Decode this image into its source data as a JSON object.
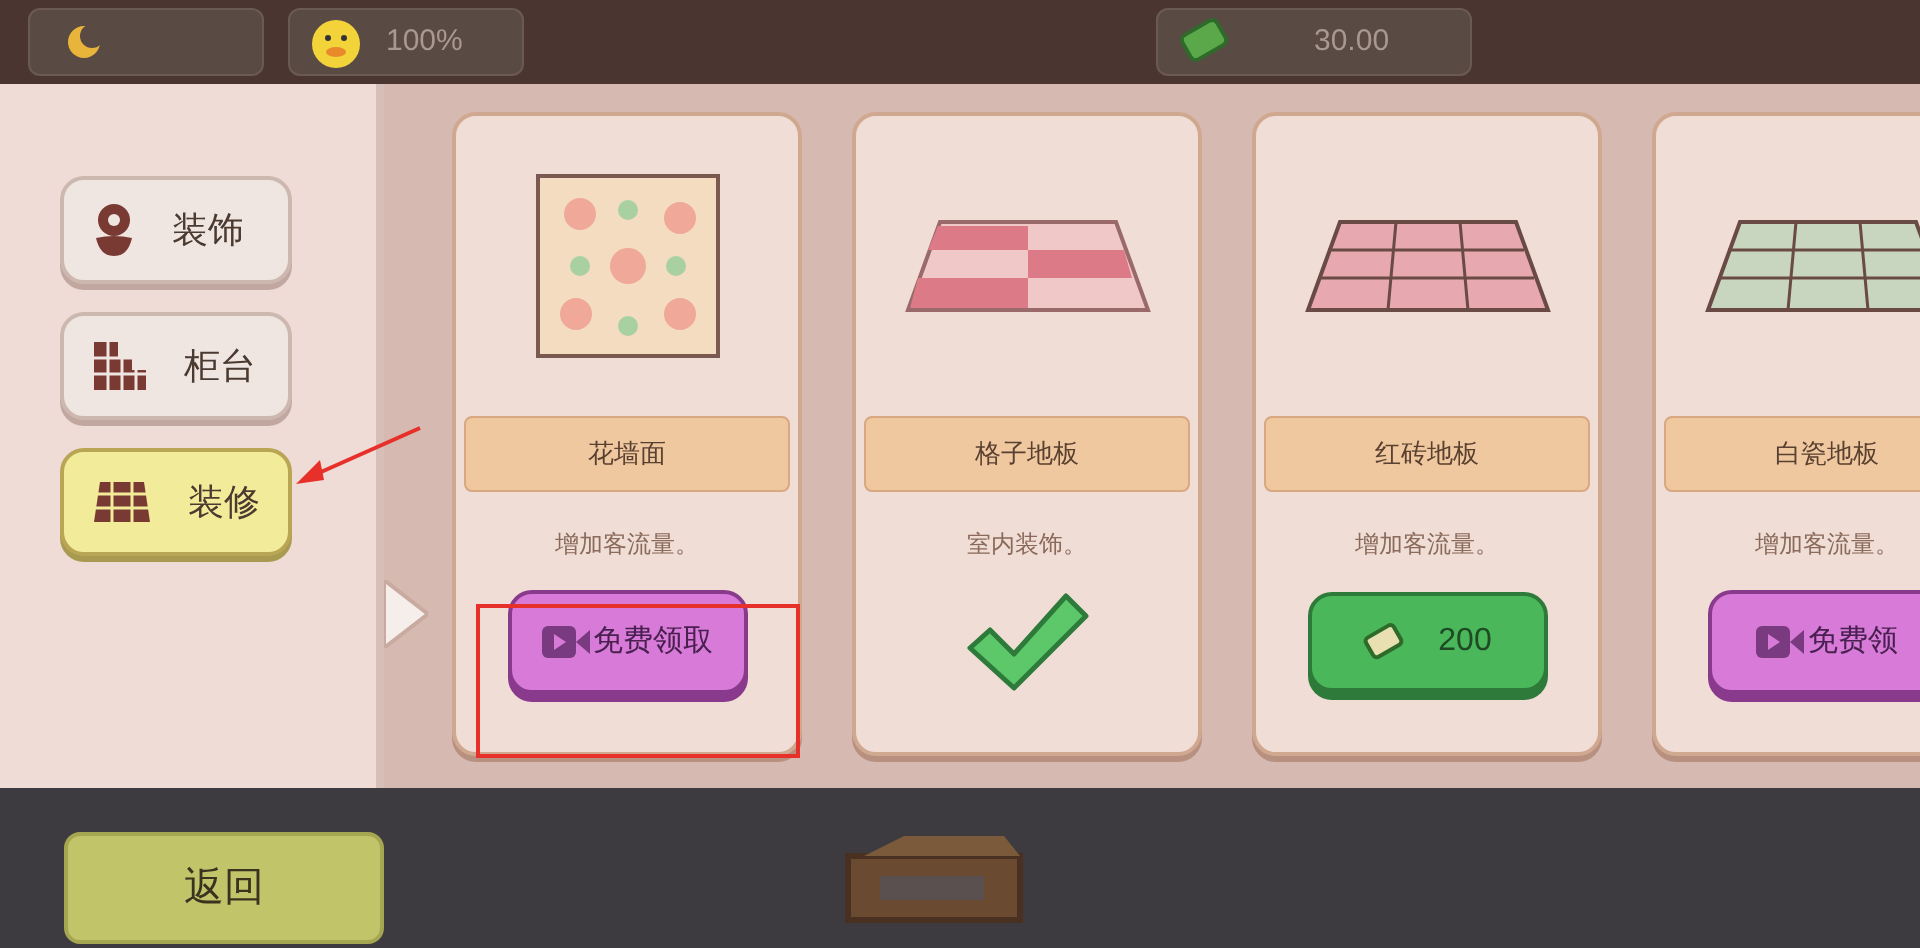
{
  "status_bar": {
    "mood": "100%",
    "money": "30.00"
  },
  "categories": [
    {
      "label": "装饰",
      "selected": false
    },
    {
      "label": "柜台",
      "selected": false
    },
    {
      "label": "装修",
      "selected": true
    }
  ],
  "items": [
    {
      "name": "花墙面",
      "description": "增加客流量。",
      "kind": "video",
      "button": "免费领取"
    },
    {
      "name": "格子地板",
      "description": "室内装饰。",
      "kind": "owned"
    },
    {
      "name": "红砖地板",
      "description": "增加客流量。",
      "kind": "price",
      "button": "200"
    },
    {
      "name": "白瓷地板",
      "description": "增加客流量。",
      "kind": "video",
      "button": "免费领"
    }
  ],
  "back_button": "返回"
}
